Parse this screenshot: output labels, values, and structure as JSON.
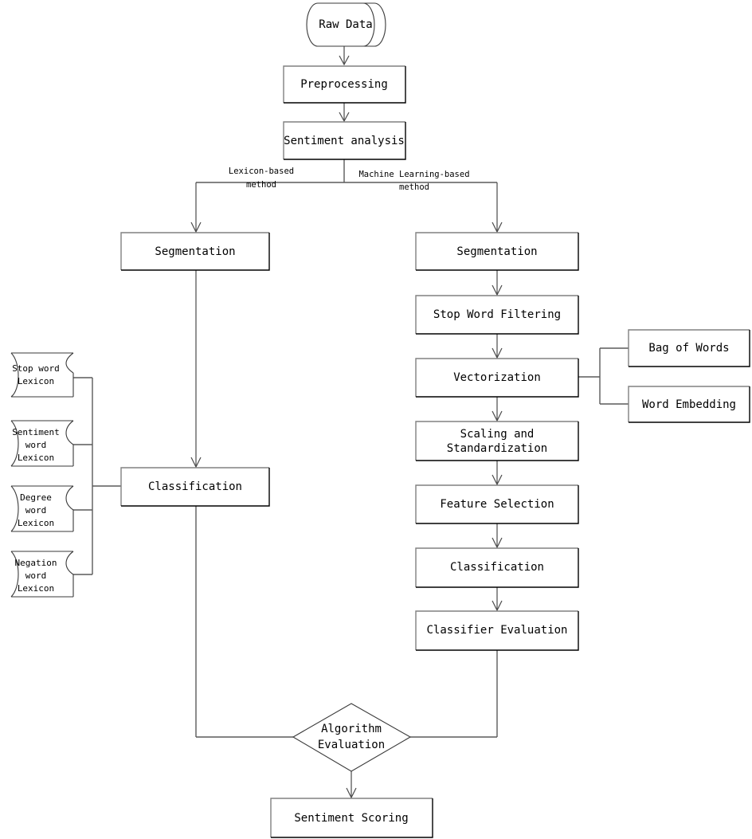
{
  "diagram": {
    "title": "Sentiment Analysis Pipeline Flowchart",
    "nodes": {
      "raw_data": "Raw Data",
      "preprocessing": "Preprocessing",
      "sentiment_analysis": "Sentiment analysis",
      "lex_segmentation": "Segmentation",
      "lex_classification": "Classification",
      "ml_segmentation": "Segmentation",
      "stop_word_filtering": "Stop Word Filtering",
      "vectorization": "Vectorization",
      "scaling_line1": "Scaling and",
      "scaling_line2": "Standardization",
      "feature_selection": "Feature Selection",
      "ml_classification": "Classification",
      "classifier_evaluation": "Classifier Evaluation",
      "bag_of_words": "Bag of Words",
      "word_embedding": "Word Embedding",
      "algorithm_evaluation_line1": "Algorithm",
      "algorithm_evaluation_line2": "Evaluation",
      "sentiment_scoring": "Sentiment Scoring"
    },
    "lexicons": [
      {
        "id": "stop-word-lexicon",
        "line1": "Stop word",
        "line2": "Lexicon",
        "line3": ""
      },
      {
        "id": "sentiment-word-lexicon",
        "line1": "Sentiment",
        "line2": "word",
        "line3": "Lexicon"
      },
      {
        "id": "degree-word-lexicon",
        "line1": "Degree",
        "line2": "word",
        "line3": "Lexicon"
      },
      {
        "id": "negation-word-lexicon",
        "line1": "Negation",
        "line2": "word",
        "line3": "Lexicon"
      }
    ],
    "edge_labels": {
      "lexicon_based_line1": "Lexicon-based",
      "lexicon_based_line2": "method",
      "ml_based_line1": "Machine Learning-based",
      "ml_based_line2": "method"
    },
    "colors": {
      "background": "#ffffff",
      "stroke_dark": "#000000",
      "stroke_light": "#808080",
      "connector": "#4a4a4a",
      "text": "#000000"
    }
  }
}
